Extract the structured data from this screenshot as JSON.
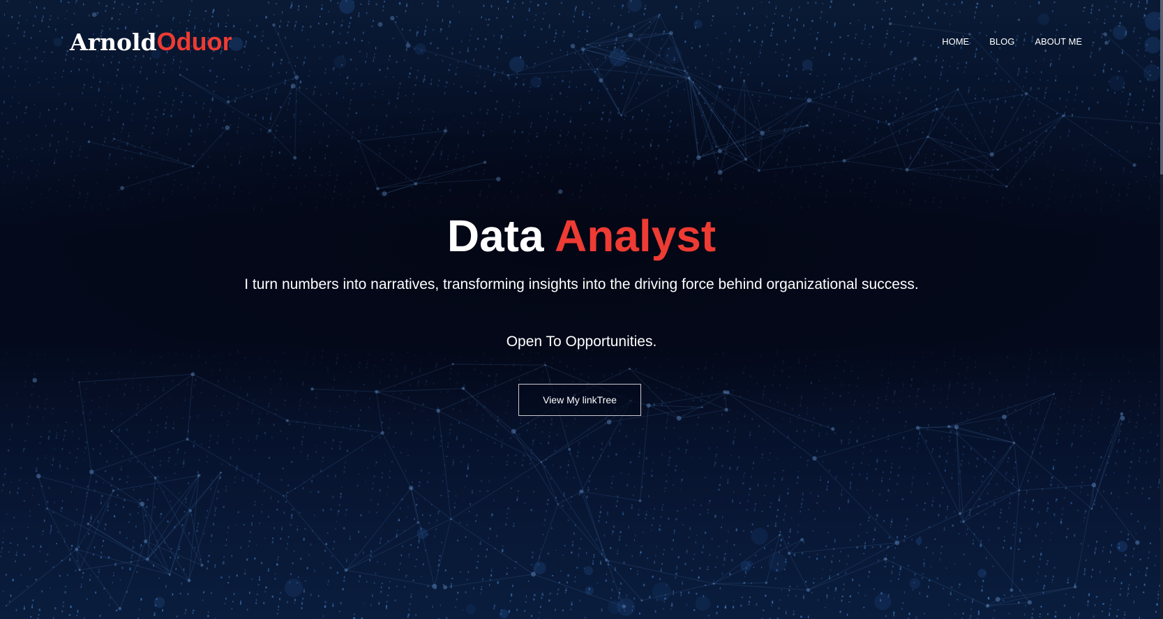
{
  "logo": {
    "first": "Arnold",
    "last": "Oduor"
  },
  "nav": {
    "items": [
      {
        "label": "HOME"
      },
      {
        "label": "BLOG"
      },
      {
        "label": "ABOUT ME"
      }
    ]
  },
  "hero": {
    "title_white": "Data",
    "title_red": "Analyst",
    "tagline": "I turn numbers into narratives, transforming insights into the driving force behind organizational success.",
    "status": "Open To Opportunities.",
    "cta_label": "View My linkTree"
  },
  "colors": {
    "accent": "#ee3b33",
    "background": "#050b1e",
    "text": "#ffffff"
  }
}
